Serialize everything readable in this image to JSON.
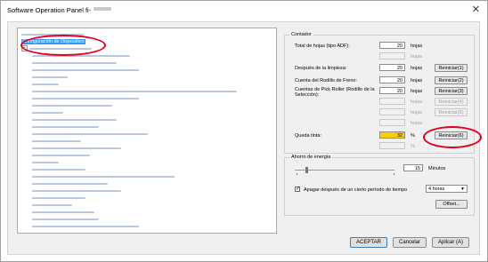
{
  "window": {
    "title": "Software Operation Panel fi-"
  },
  "tree": {
    "items": [
      {
        "label": "",
        "level": 0,
        "expander": "",
        "blur": 70
      },
      {
        "label": "Configuración de Dispositivo",
        "level": 0,
        "expander": "",
        "selected": true
      },
      {
        "label": "",
        "level": 0,
        "expander": "−",
        "blur": 70
      },
      {
        "label": "",
        "level": 1,
        "blur": 110
      },
      {
        "label": "",
        "level": 1,
        "blur": 95
      },
      {
        "label": "",
        "level": 1,
        "blur": 120
      },
      {
        "label": "",
        "level": 1,
        "blur": 40
      },
      {
        "label": "",
        "level": 1,
        "blur": 30
      },
      {
        "label": "",
        "level": 1,
        "blur": 230
      },
      {
        "label": "",
        "level": 1,
        "blur": 120
      },
      {
        "label": "",
        "level": 1,
        "blur": 90
      },
      {
        "label": "",
        "level": 1,
        "blur": 35
      },
      {
        "label": "",
        "level": 1,
        "blur": 95
      },
      {
        "label": "",
        "level": 1,
        "blur": 75
      },
      {
        "label": "",
        "level": 1,
        "blur": 130
      },
      {
        "label": "",
        "level": 1,
        "blur": 55
      },
      {
        "label": "",
        "level": 1,
        "blur": 100
      },
      {
        "label": "",
        "level": 1,
        "blur": 65
      },
      {
        "label": "",
        "level": 1,
        "blur": 30
      },
      {
        "label": "",
        "level": 1,
        "blur": 60
      },
      {
        "label": "",
        "level": 1,
        "blur": 160
      },
      {
        "label": "",
        "level": 1,
        "blur": 85
      },
      {
        "label": "",
        "level": 1,
        "blur": 100
      },
      {
        "label": "",
        "level": 1,
        "blur": 60
      },
      {
        "label": "",
        "level": 1,
        "blur": 45
      },
      {
        "label": "",
        "level": 1,
        "blur": 70
      },
      {
        "label": "",
        "level": 1,
        "blur": 75
      },
      {
        "label": "",
        "level": 1,
        "blur": 120
      }
    ]
  },
  "counter": {
    "title": "Contador",
    "total_label": "Total de hojas (tipo ADF):",
    "total_value": "20",
    "total_unit": "hojas",
    "blank_unit": "hojas",
    "cleaning_label": "Después de la limpieza:",
    "cleaning_value": "20",
    "cleaning_unit": "hojas",
    "reset1": "Reiniciar(1)",
    "brake_label": "Cuenta del Rodillo de Freno:",
    "brake_value": "20",
    "brake_unit": "hojas",
    "reset2": "Reiniciar(2)",
    "pick_label": "Cuentas de Pick Roller (Rodillo de la Selección):",
    "pick_value": "20",
    "pick_unit": "hojas",
    "reset3": "Reiniciar(3)",
    "dis_unit1": "hojas",
    "reset4": "Reiniciar(4)",
    "dis_unit2": "hojas",
    "reset5": "Reiniciar(5)",
    "dis_unit3": "hojas",
    "ink_label": "Queda tinta:",
    "ink_value": "32",
    "ink_unit": "%",
    "reset6": "Reiniciar(6)",
    "ink_unit2": "%"
  },
  "energy": {
    "title": "Ahorro de energía",
    "minutes_value": "15",
    "minutes_unit": "Minutos",
    "auto_off_label": "Apagar después de un cierto período de tiempo",
    "auto_off_checked": "✓",
    "hours_select": "4 horas",
    "offset_button": "Offset..."
  },
  "footer": {
    "accept": "ACEPTAR",
    "cancel": "Cancelar",
    "apply": "Aplicar (A)"
  },
  "colors": {
    "highlight": "#ffcc00",
    "selection": "#3399ff",
    "annotation": "#e3001b"
  }
}
